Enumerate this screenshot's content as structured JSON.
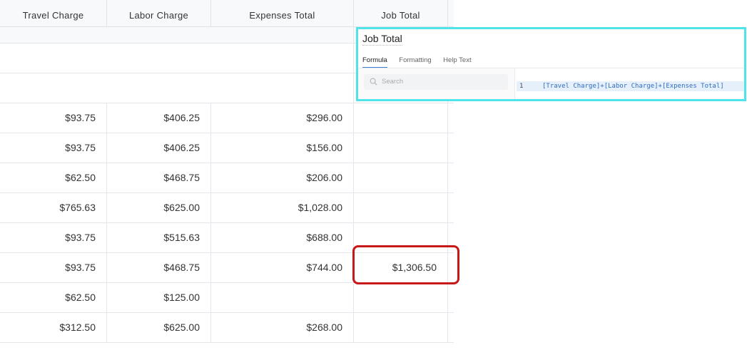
{
  "table": {
    "columns": [
      "Travel Charge",
      "Labor Charge",
      "Expenses Total",
      "Job Total"
    ],
    "rows": [
      {
        "travel": "$93.75",
        "labor": "$406.25",
        "expenses": "$296.00",
        "job_total": ""
      },
      {
        "travel": "$93.75",
        "labor": "$406.25",
        "expenses": "$156.00",
        "job_total": ""
      },
      {
        "travel": "$62.50",
        "labor": "$468.75",
        "expenses": "$206.00",
        "job_total": ""
      },
      {
        "travel": "$765.63",
        "labor": "$625.00",
        "expenses": "$1,028.00",
        "job_total": ""
      },
      {
        "travel": "$93.75",
        "labor": "$515.63",
        "expenses": "$688.00",
        "job_total": ""
      },
      {
        "travel": "$93.75",
        "labor": "$468.75",
        "expenses": "$744.00",
        "job_total": "$1,306.50"
      },
      {
        "travel": "$62.50",
        "labor": "$125.00",
        "expenses": "",
        "job_total": ""
      },
      {
        "travel": "$312.50",
        "labor": "$625.00",
        "expenses": "$268.00",
        "job_total": ""
      }
    ]
  },
  "popup": {
    "title": "Job Total",
    "tabs": [
      "Formula",
      "Formatting",
      "Help Text"
    ],
    "active_tab": "Formula",
    "search_placeholder": "Search",
    "editor": {
      "line_number": "1",
      "formula": "[Travel Charge]+[Labor Charge]+[Expenses Total]"
    }
  },
  "colors": {
    "highlight": "#c8191a",
    "popup_border": "#4fe3ea",
    "active_tab": "#3b7fd6",
    "formula_text": "#2e6bc4"
  }
}
